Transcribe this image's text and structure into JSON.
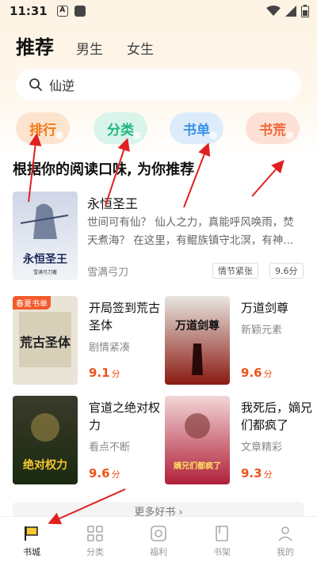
{
  "status_bar": {
    "time": "11:31"
  },
  "header": {
    "tabs": [
      {
        "label": "推荐"
      },
      {
        "label": "男生"
      },
      {
        "label": "女生"
      }
    ]
  },
  "search": {
    "value": "仙逆"
  },
  "categories": [
    {
      "label": "排行"
    },
    {
      "label": "分类"
    },
    {
      "label": "书单"
    },
    {
      "label": "书荒"
    }
  ],
  "section": {
    "title": "根据你的阅读口味, 为你推荐"
  },
  "featured": {
    "title": "永恒圣王",
    "description": "世间可有仙？ 仙人之力，真能呼风唤雨，焚天煮海？ 在这里，有鲲族镇守北溟，有神...",
    "author": "雪满弓刀",
    "tags": [
      "情节紧张",
      "9.6分"
    ],
    "cover_text": "永恒圣王",
    "cover_author": "雪满弓刀著"
  },
  "grid_books": [
    {
      "title": "开局签到荒古圣体",
      "subtitle": "剧情紧凑",
      "score": "9.1",
      "unit": "分",
      "badge": "春夏书单",
      "cover_text": "荒古圣体"
    },
    {
      "title": "万道剑尊",
      "subtitle": "新颖元素",
      "score": "9.6",
      "unit": "分",
      "cover_text": "万道剑尊"
    },
    {
      "title": "官道之绝对权力",
      "subtitle": "看点不断",
      "score": "9.6",
      "unit": "分",
      "cover_text": "绝对权力"
    },
    {
      "title": "我死后，嫡兄们都疯了",
      "subtitle": "文章精彩",
      "score": "9.3",
      "unit": "分",
      "cover_text": "嫡兄们都疯了"
    }
  ],
  "more": {
    "label": "更多好书 ›"
  },
  "bottom_nav": [
    {
      "label": "书城",
      "icon": "bookstore-flag-icon"
    },
    {
      "label": "分类",
      "icon": "grid-icon"
    },
    {
      "label": "福利",
      "icon": "gift-icon"
    },
    {
      "label": "书架",
      "icon": "bookshelf-icon"
    },
    {
      "label": "我的",
      "icon": "person-icon"
    }
  ],
  "colors": {
    "accent": "#f0531c",
    "rank": "#f07a1a",
    "category": "#1fb67f",
    "booklist": "#3c92e8",
    "bookshortage": "#f06a39",
    "annotation_arrow": "#e02020"
  }
}
